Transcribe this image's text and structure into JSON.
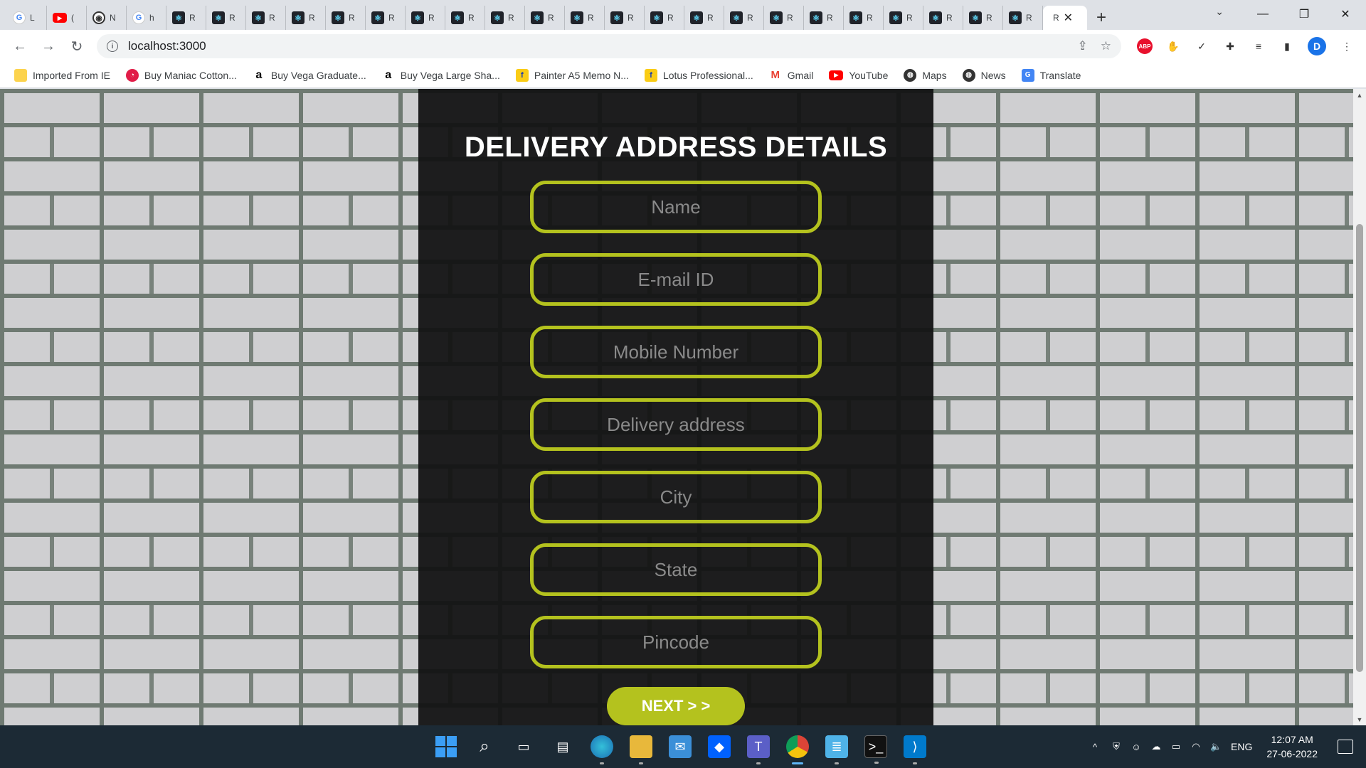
{
  "browser": {
    "tabs": [
      {
        "icon": "google-icon",
        "glyph": "G",
        "title": "L"
      },
      {
        "icon": "youtube-icon",
        "glyph": "▶",
        "title": "("
      },
      {
        "icon": "github-icon",
        "glyph": "◉",
        "title": "N"
      },
      {
        "icon": "google-icon",
        "glyph": "G",
        "title": "h"
      },
      {
        "icon": "react-icon",
        "glyph": "⚛",
        "title": "R"
      },
      {
        "icon": "react-icon",
        "glyph": "⚛",
        "title": "R"
      },
      {
        "icon": "react-icon",
        "glyph": "⚛",
        "title": "R"
      },
      {
        "icon": "react-icon",
        "glyph": "⚛",
        "title": "R"
      },
      {
        "icon": "react-icon",
        "glyph": "⚛",
        "title": "R"
      },
      {
        "icon": "react-icon",
        "glyph": "⚛",
        "title": "R"
      },
      {
        "icon": "react-icon",
        "glyph": "⚛",
        "title": "R"
      },
      {
        "icon": "react-icon",
        "glyph": "⚛",
        "title": "R"
      },
      {
        "icon": "react-icon",
        "glyph": "⚛",
        "title": "R"
      },
      {
        "icon": "react-icon",
        "glyph": "⚛",
        "title": "R"
      },
      {
        "icon": "react-icon",
        "glyph": "⚛",
        "title": "R"
      },
      {
        "icon": "react-icon",
        "glyph": "⚛",
        "title": "R"
      },
      {
        "icon": "react-icon",
        "glyph": "⚛",
        "title": "R"
      },
      {
        "icon": "react-icon",
        "glyph": "⚛",
        "title": "R"
      },
      {
        "icon": "react-icon",
        "glyph": "⚛",
        "title": "R"
      },
      {
        "icon": "react-icon",
        "glyph": "⚛",
        "title": "R"
      },
      {
        "icon": "react-icon",
        "glyph": "⚛",
        "title": "R"
      },
      {
        "icon": "react-icon",
        "glyph": "⚛",
        "title": "R"
      },
      {
        "icon": "react-icon",
        "glyph": "⚛",
        "title": "R"
      },
      {
        "icon": "react-icon",
        "glyph": "⚛",
        "title": "R"
      },
      {
        "icon": "react-icon",
        "glyph": "⚛",
        "title": "R"
      },
      {
        "icon": "react-icon",
        "glyph": "⚛",
        "title": "R"
      }
    ],
    "active_tab": {
      "title": "R",
      "close": "✕"
    },
    "new_tab": "+",
    "tab_search": "⌄",
    "window": {
      "minimize": "—",
      "maximize": "❐",
      "close": "✕"
    },
    "nav": {
      "back": "←",
      "forward": "→",
      "reload": "↻"
    },
    "address": {
      "info": "i",
      "url": "localhost:3000",
      "share": "⇪",
      "star": "☆"
    },
    "extensions": [
      {
        "icon": "adblock-plus-icon",
        "glyph": "ABP"
      },
      {
        "icon": "hand-icon",
        "glyph": "✋"
      },
      {
        "icon": "checkmark-icon",
        "glyph": "✓"
      },
      {
        "icon": "puzzle-icon",
        "glyph": "✚"
      },
      {
        "icon": "media-queue-icon",
        "glyph": "≡"
      },
      {
        "icon": "side-panel-icon",
        "glyph": "▮"
      }
    ],
    "profile_initial": "D",
    "menu": "⋮",
    "bookmarks": [
      {
        "icon": "folder-icon",
        "cls": "folder",
        "glyph": "",
        "label": "Imported From IE"
      },
      {
        "icon": "maniac-icon",
        "cls": "pink",
        "glyph": "◔",
        "label": "Buy Maniac Cotton..."
      },
      {
        "icon": "amazon-icon",
        "cls": "amazon",
        "glyph": "a",
        "label": "Buy Vega Graduate..."
      },
      {
        "icon": "amazon-icon",
        "cls": "amazon",
        "glyph": "a",
        "label": "Buy Vega Large Sha..."
      },
      {
        "icon": "flipkart-icon",
        "cls": "yellowbird",
        "glyph": "f",
        "label": "Painter A5 Memo N..."
      },
      {
        "icon": "flipkart-icon",
        "cls": "yellowbird",
        "glyph": "f",
        "label": "Lotus Professional..."
      },
      {
        "icon": "gmail-icon",
        "cls": "gmail",
        "glyph": "M",
        "label": "Gmail"
      },
      {
        "icon": "youtube-icon",
        "cls": "yt",
        "glyph": "▶",
        "label": "YouTube"
      },
      {
        "icon": "globe-icon",
        "cls": "globe",
        "glyph": "◍",
        "label": "Maps"
      },
      {
        "icon": "globe-icon",
        "cls": "globe",
        "glyph": "◍",
        "label": "News"
      },
      {
        "icon": "translate-icon",
        "cls": "translate",
        "glyph": "G",
        "label": "Translate"
      }
    ]
  },
  "form": {
    "title": "DELIVERY ADDRESS DETAILS",
    "accent": "#b4c21e",
    "fields": [
      {
        "name": "name-input",
        "placeholder": "Name",
        "value": ""
      },
      {
        "name": "email-input",
        "placeholder": "E-mail ID",
        "value": ""
      },
      {
        "name": "mobile-input",
        "placeholder": "Mobile Number",
        "value": ""
      },
      {
        "name": "address-input",
        "placeholder": "Delivery address",
        "value": ""
      },
      {
        "name": "city-input",
        "placeholder": "City",
        "value": ""
      },
      {
        "name": "state-input",
        "placeholder": "State",
        "value": ""
      },
      {
        "name": "pincode-input",
        "placeholder": "Pincode",
        "value": ""
      }
    ],
    "next_label": "NEXT > >"
  },
  "scrollbar": {
    "up": "▲",
    "down": "▼"
  },
  "taskbar": {
    "apps": [
      {
        "icon": "windows-start-icon",
        "cls": "win",
        "glyph": ""
      },
      {
        "icon": "search-icon",
        "cls": "search",
        "glyph": "⌕"
      },
      {
        "icon": "task-view-icon",
        "cls": "",
        "glyph": "▭"
      },
      {
        "icon": "widgets-icon",
        "cls": "",
        "glyph": "▤"
      },
      {
        "icon": "edge-icon",
        "cls": "edge",
        "glyph": ""
      },
      {
        "icon": "file-explorer-icon",
        "cls": "files",
        "glyph": ""
      },
      {
        "icon": "mail-icon",
        "cls": "mail",
        "glyph": "✉"
      },
      {
        "icon": "dropbox-icon",
        "cls": "dropbox",
        "glyph": "◆"
      },
      {
        "icon": "teams-icon",
        "cls": "teams",
        "glyph": "T"
      },
      {
        "icon": "chrome-icon",
        "cls": "chrome",
        "glyph": ""
      },
      {
        "icon": "notepad-icon",
        "cls": "notepad",
        "glyph": "≣"
      },
      {
        "icon": "terminal-icon",
        "cls": "terminal",
        "glyph": ">_"
      },
      {
        "icon": "vscode-icon",
        "cls": "vscode",
        "glyph": "⟩"
      }
    ],
    "tray": {
      "chevron": "^",
      "icons": [
        {
          "icon": "shield-icon",
          "glyph": "⛨"
        },
        {
          "icon": "people-icon",
          "glyph": "☺"
        },
        {
          "icon": "cloud-icon",
          "glyph": "☁"
        },
        {
          "icon": "battery-icon",
          "glyph": "▭"
        },
        {
          "icon": "wifi-icon",
          "glyph": "◠"
        },
        {
          "icon": "volume-icon",
          "glyph": "🔈"
        }
      ],
      "lang": "ENG",
      "time": "12:07 AM",
      "date": "27-06-2022"
    }
  }
}
